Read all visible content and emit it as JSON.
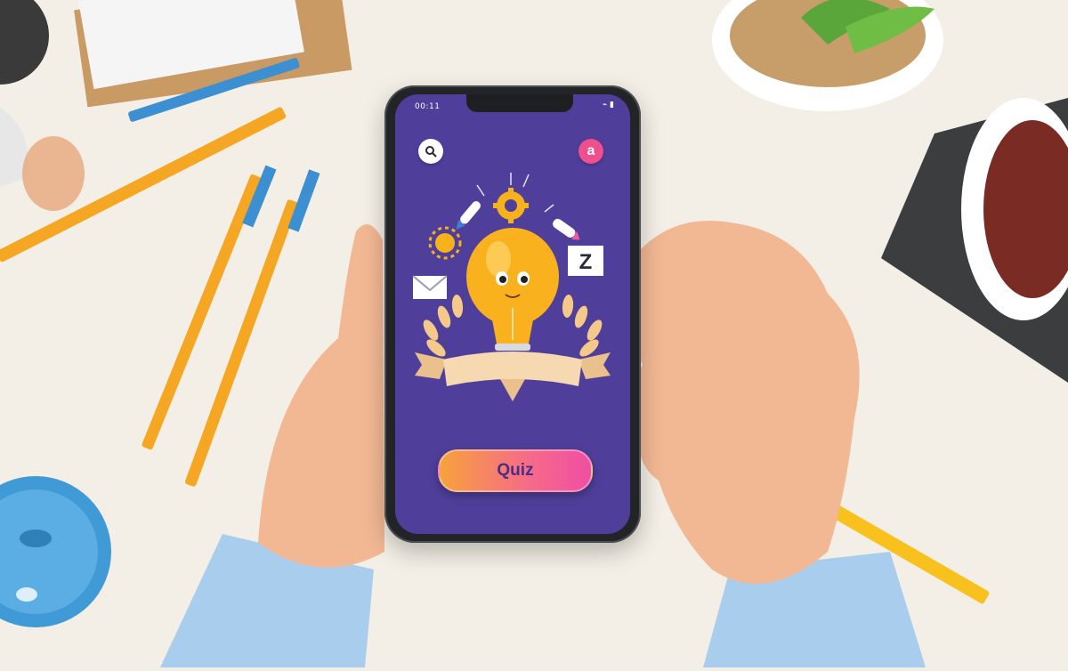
{
  "status_bar": {
    "time": "00:11",
    "icons": "⌁ ▮"
  },
  "header": {
    "search_icon": "search-icon",
    "profile_letter": "a"
  },
  "illustration": {
    "badge_letter": "Z"
  },
  "cta": {
    "label": "Quiz"
  },
  "colors": {
    "screen_bg": "#4f3f9b",
    "accent_pink": "#ef4f8c",
    "button_gradient_start": "#f7a23c",
    "button_gradient_end": "#f04ea2",
    "bulb": "#f9b21d"
  }
}
